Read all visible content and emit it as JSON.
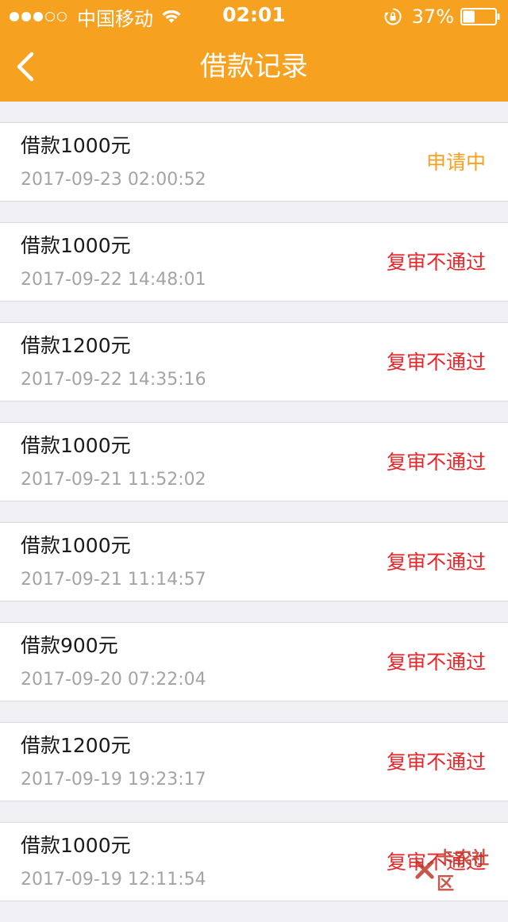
{
  "status_bar": {
    "signal_dots": [
      true,
      true,
      true,
      false,
      false
    ],
    "carrier": "中国移动",
    "time": "02:01",
    "battery_percent": "37%",
    "battery_level": 0.37,
    "icons": [
      "wifi-icon",
      "orientation-lock-icon",
      "battery-icon"
    ]
  },
  "nav": {
    "title": "借款记录",
    "back_icon": "chevron-left-icon"
  },
  "colors": {
    "header_bg": "#f6a220",
    "pending": "#f6a220",
    "rejected": "#e8262a",
    "time_text": "#a4a4a4"
  },
  "records": [
    {
      "title": "借款1000元",
      "time": "2017-09-23 02:00:52",
      "status": "申请中",
      "status_type": "pending"
    },
    {
      "title": "借款1000元",
      "time": "2017-09-22 14:48:01",
      "status": "复审不通过",
      "status_type": "rejected"
    },
    {
      "title": "借款1200元",
      "time": "2017-09-22 14:35:16",
      "status": "复审不通过",
      "status_type": "rejected"
    },
    {
      "title": "借款1000元",
      "time": "2017-09-21 11:52:02",
      "status": "复审不通过",
      "status_type": "rejected"
    },
    {
      "title": "借款1000元",
      "time": "2017-09-21 11:14:57",
      "status": "复审不通过",
      "status_type": "rejected"
    },
    {
      "title": "借款900元",
      "time": "2017-09-20 07:22:04",
      "status": "复审不通过",
      "status_type": "rejected"
    },
    {
      "title": "借款1200元",
      "time": "2017-09-19 19:23:17",
      "status": "复审不通过",
      "status_type": "rejected"
    },
    {
      "title": "借款1000元",
      "time": "2017-09-19 12:11:54",
      "status": "复审不通过",
      "status_type": "rejected"
    }
  ],
  "watermark": {
    "text": "卡农社区"
  }
}
